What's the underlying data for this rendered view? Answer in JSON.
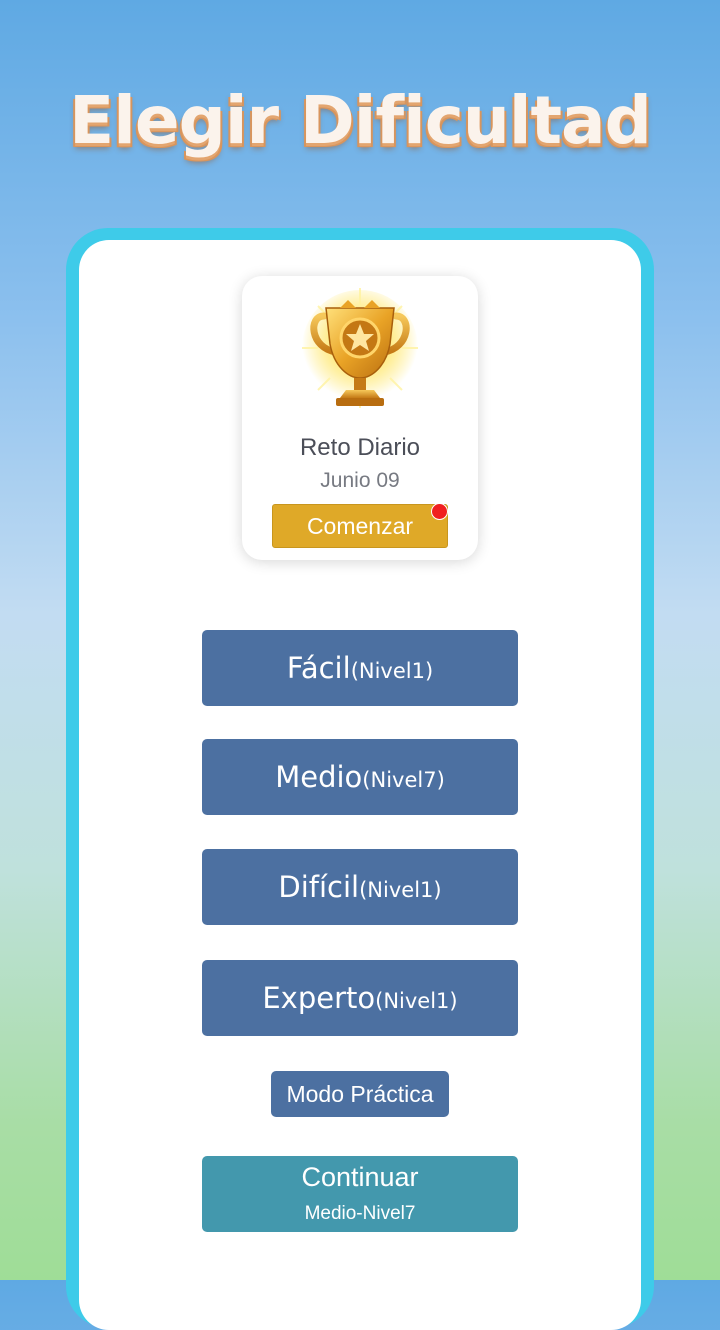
{
  "page_title": "Elegir Dificultad",
  "daily_challenge": {
    "title": "Reto Diario",
    "date": "Junio 09",
    "start_label": "Comenzar",
    "icon": "trophy-icon",
    "has_notification": true
  },
  "levels": [
    {
      "name": "Fácil",
      "level": "(Nivel1)"
    },
    {
      "name": "Medio",
      "level": "(Nivel7)"
    },
    {
      "name": "Difícil",
      "level": "(Nivel1)"
    },
    {
      "name": "Experto",
      "level": "(Nivel1)"
    }
  ],
  "practice_label": "Modo Práctica",
  "continue": {
    "label": "Continuar",
    "sub": "Medio-Nivel7"
  },
  "colors": {
    "level_button": "#4c70a1",
    "continue_button": "#4398ad",
    "start_button": "#dfa928",
    "card_border": "#3ecbe9",
    "notification_dot": "#f01f1f"
  }
}
